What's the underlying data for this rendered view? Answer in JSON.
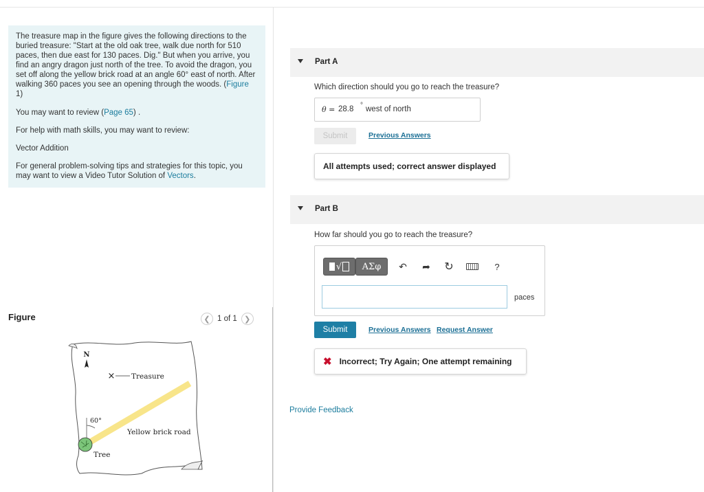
{
  "problem": {
    "lines": [
      "The treasure map in the figure gives the following directions to the",
      "buried treasure: \"Start at the old oak tree, walk due north for 510",
      "paces, then due east for 130 paces. Dig.\" But when you arrive, you",
      "find an angry dragon just north of the tree. To avoid the dragon, you",
      "set off along the yellow brick road at an angle 60° east of north. After",
      "walking 360 paces you see an opening through the woods. (Figure",
      "1)"
    ],
    "figure_link": "Figure",
    "review_prefix": "You may want to review (",
    "review_link": "Page 65",
    "review_suffix": ") .",
    "math_help": "For help with math skills, you may want to review:",
    "vector_addition": "Vector Addition",
    "tips_line1": "For general problem-solving tips and strategies for this topic, you",
    "tips_line2_prefix": "may want to view a Video Tutor Solution of ",
    "tips_link": "Vectors",
    "tips_suffix": "."
  },
  "figure": {
    "title": "Figure",
    "pager_text": "1 of 1",
    "prev_icon": "chevron-left-icon",
    "next_icon": "chevron-right-icon",
    "map": {
      "north_label": "N",
      "treasure_label": "Treasure",
      "angle_label": "60°",
      "road_label": "Yellow brick road",
      "tree_label": "Tree",
      "road_color": "#f8e58a"
    }
  },
  "partA": {
    "label": "Part A",
    "question": "Which direction should you go to reach the treasure?",
    "answer_symbol": "θ =",
    "answer_value": "28.8",
    "answer_unit": "°",
    "answer_suffix": "west of north",
    "submit_label": "Submit",
    "previous_answers": "Previous Answers",
    "status": "All attempts used; correct answer displayed"
  },
  "partB": {
    "label": "Part B",
    "question": "How far should you go to reach the treasure?",
    "toolbar": {
      "templates_icon": "templates-icon",
      "greek_label": "ΑΣφ",
      "undo_icon": "undo-icon",
      "redo_icon": "redo-icon",
      "reset_icon": "reset-icon",
      "keyboard_icon": "keyboard-icon",
      "help_label": "?"
    },
    "input_value": "",
    "units": "paces",
    "submit_label": "Submit",
    "previous_answers": "Previous Answers",
    "request_answer": "Request Answer",
    "status": "Incorrect; Try Again; One attempt remaining",
    "status_color": "#c8102e"
  },
  "feedback_link": "Provide Feedback",
  "colors": {
    "accent": "#1e7fa5",
    "link": "#1b7c9d",
    "info_bg": "#e8f4f6"
  }
}
